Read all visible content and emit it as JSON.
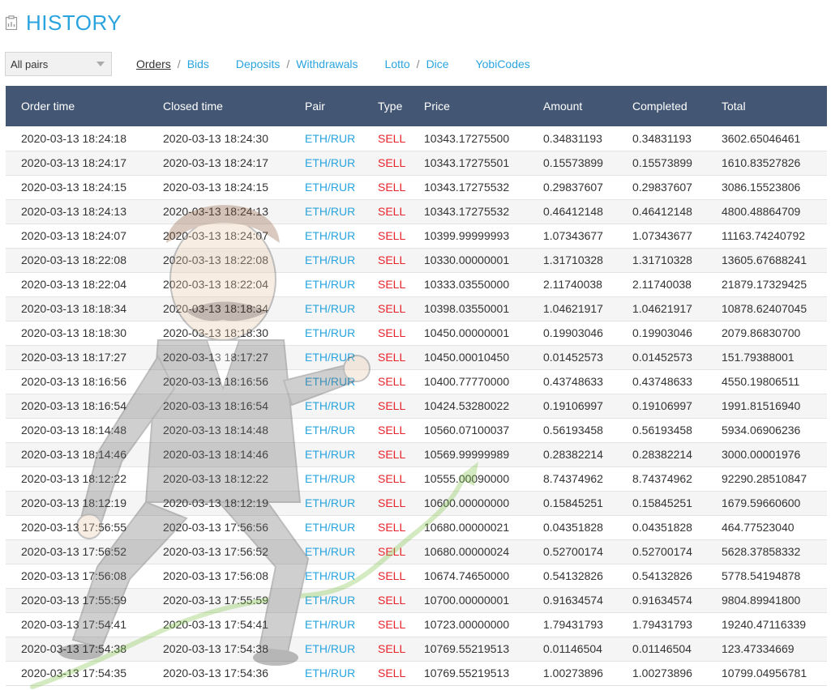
{
  "page": {
    "title": "HISTORY"
  },
  "filter": {
    "selected": "All pairs"
  },
  "nav": {
    "orders": "Orders",
    "bids": "Bids",
    "deposits": "Deposits",
    "withdrawals": "Withdrawals",
    "lotto": "Lotto",
    "dice": "Dice",
    "yobicodes": "YobiCodes",
    "separator": "/"
  },
  "table": {
    "headers": [
      "Order time",
      "Closed time",
      "Pair",
      "Type",
      "Price",
      "Amount",
      "Completed",
      "Total"
    ],
    "rows": [
      [
        "2020-03-13 18:24:18",
        "2020-03-13 18:24:30",
        "ETH/RUR",
        "SELL",
        "10343.17275500",
        "0.34831193",
        "0.34831193",
        "3602.65046461"
      ],
      [
        "2020-03-13 18:24:17",
        "2020-03-13 18:24:17",
        "ETH/RUR",
        "SELL",
        "10343.17275501",
        "0.15573899",
        "0.15573899",
        "1610.83527826"
      ],
      [
        "2020-03-13 18:24:15",
        "2020-03-13 18:24:15",
        "ETH/RUR",
        "SELL",
        "10343.17275532",
        "0.29837607",
        "0.29837607",
        "3086.15523806"
      ],
      [
        "2020-03-13 18:24:13",
        "2020-03-13 18:24:13",
        "ETH/RUR",
        "SELL",
        "10343.17275532",
        "0.46412148",
        "0.46412148",
        "4800.48864709"
      ],
      [
        "2020-03-13 18:24:07",
        "2020-03-13 18:24:07",
        "ETH/RUR",
        "SELL",
        "10399.99999993",
        "1.07343677",
        "1.07343677",
        "11163.74240792"
      ],
      [
        "2020-03-13 18:22:08",
        "2020-03-13 18:22:08",
        "ETH/RUR",
        "SELL",
        "10330.00000001",
        "1.31710328",
        "1.31710328",
        "13605.67688241"
      ],
      [
        "2020-03-13 18:22:04",
        "2020-03-13 18:22:04",
        "ETH/RUR",
        "SELL",
        "10333.03550000",
        "2.11740038",
        "2.11740038",
        "21879.17329425"
      ],
      [
        "2020-03-13 18:18:34",
        "2020-03-13 18:18:34",
        "ETH/RUR",
        "SELL",
        "10398.03550001",
        "1.04621917",
        "1.04621917",
        "10878.62407045"
      ],
      [
        "2020-03-13 18:18:30",
        "2020-03-13 18:18:30",
        "ETH/RUR",
        "SELL",
        "10450.00000001",
        "0.19903046",
        "0.19903046",
        "2079.86830700"
      ],
      [
        "2020-03-13 18:17:27",
        "2020-03-13 18:17:27",
        "ETH/RUR",
        "SELL",
        "10450.00010450",
        "0.01452573",
        "0.01452573",
        "151.79388001"
      ],
      [
        "2020-03-13 18:16:56",
        "2020-03-13 18:16:56",
        "ETH/RUR",
        "SELL",
        "10400.77770000",
        "0.43748633",
        "0.43748633",
        "4550.19806511"
      ],
      [
        "2020-03-13 18:16:54",
        "2020-03-13 18:16:54",
        "ETH/RUR",
        "SELL",
        "10424.53280022",
        "0.19106997",
        "0.19106997",
        "1991.81516940"
      ],
      [
        "2020-03-13 18:14:48",
        "2020-03-13 18:14:48",
        "ETH/RUR",
        "SELL",
        "10560.07100037",
        "0.56193458",
        "0.56193458",
        "5934.06906236"
      ],
      [
        "2020-03-13 18:14:46",
        "2020-03-13 18:14:46",
        "ETH/RUR",
        "SELL",
        "10569.99999989",
        "0.28382214",
        "0.28382214",
        "3000.00001976"
      ],
      [
        "2020-03-13 18:12:22",
        "2020-03-13 18:12:22",
        "ETH/RUR",
        "SELL",
        "10555.00090000",
        "8.74374962",
        "8.74374962",
        "92290.28510847"
      ],
      [
        "2020-03-13 18:12:19",
        "2020-03-13 18:12:19",
        "ETH/RUR",
        "SELL",
        "10600.00000000",
        "0.15845251",
        "0.15845251",
        "1679.59660600"
      ],
      [
        "2020-03-13 17:56:55",
        "2020-03-13 17:56:56",
        "ETH/RUR",
        "SELL",
        "10680.00000021",
        "0.04351828",
        "0.04351828",
        "464.77523040"
      ],
      [
        "2020-03-13 17:56:52",
        "2020-03-13 17:56:52",
        "ETH/RUR",
        "SELL",
        "10680.00000024",
        "0.52700174",
        "0.52700174",
        "5628.37858332"
      ],
      [
        "2020-03-13 17:56:08",
        "2020-03-13 17:56:08",
        "ETH/RUR",
        "SELL",
        "10674.74650000",
        "0.54132826",
        "0.54132826",
        "5778.54194878"
      ],
      [
        "2020-03-13 17:55:59",
        "2020-03-13 17:55:59",
        "ETH/RUR",
        "SELL",
        "10700.00000001",
        "0.91634574",
        "0.91634574",
        "9804.89941800"
      ],
      [
        "2020-03-13 17:54:41",
        "2020-03-13 17:54:41",
        "ETH/RUR",
        "SELL",
        "10723.00000000",
        "1.79431793",
        "1.79431793",
        "19240.47116339"
      ],
      [
        "2020-03-13 17:54:38",
        "2020-03-13 17:54:38",
        "ETH/RUR",
        "SELL",
        "10769.55219513",
        "0.01146504",
        "0.01146504",
        "123.47334669"
      ],
      [
        "2020-03-13 17:54:35",
        "2020-03-13 17:54:36",
        "ETH/RUR",
        "SELL",
        "10769.55219513",
        "1.00273896",
        "1.00273896",
        "10799.04956781"
      ]
    ]
  },
  "colors": {
    "accent": "#2aa4df",
    "header_bg": "#435774",
    "sell": "#e8232b"
  },
  "icons": {
    "title_icon": "history-icon",
    "select_caret": "chevron-down-icon"
  }
}
